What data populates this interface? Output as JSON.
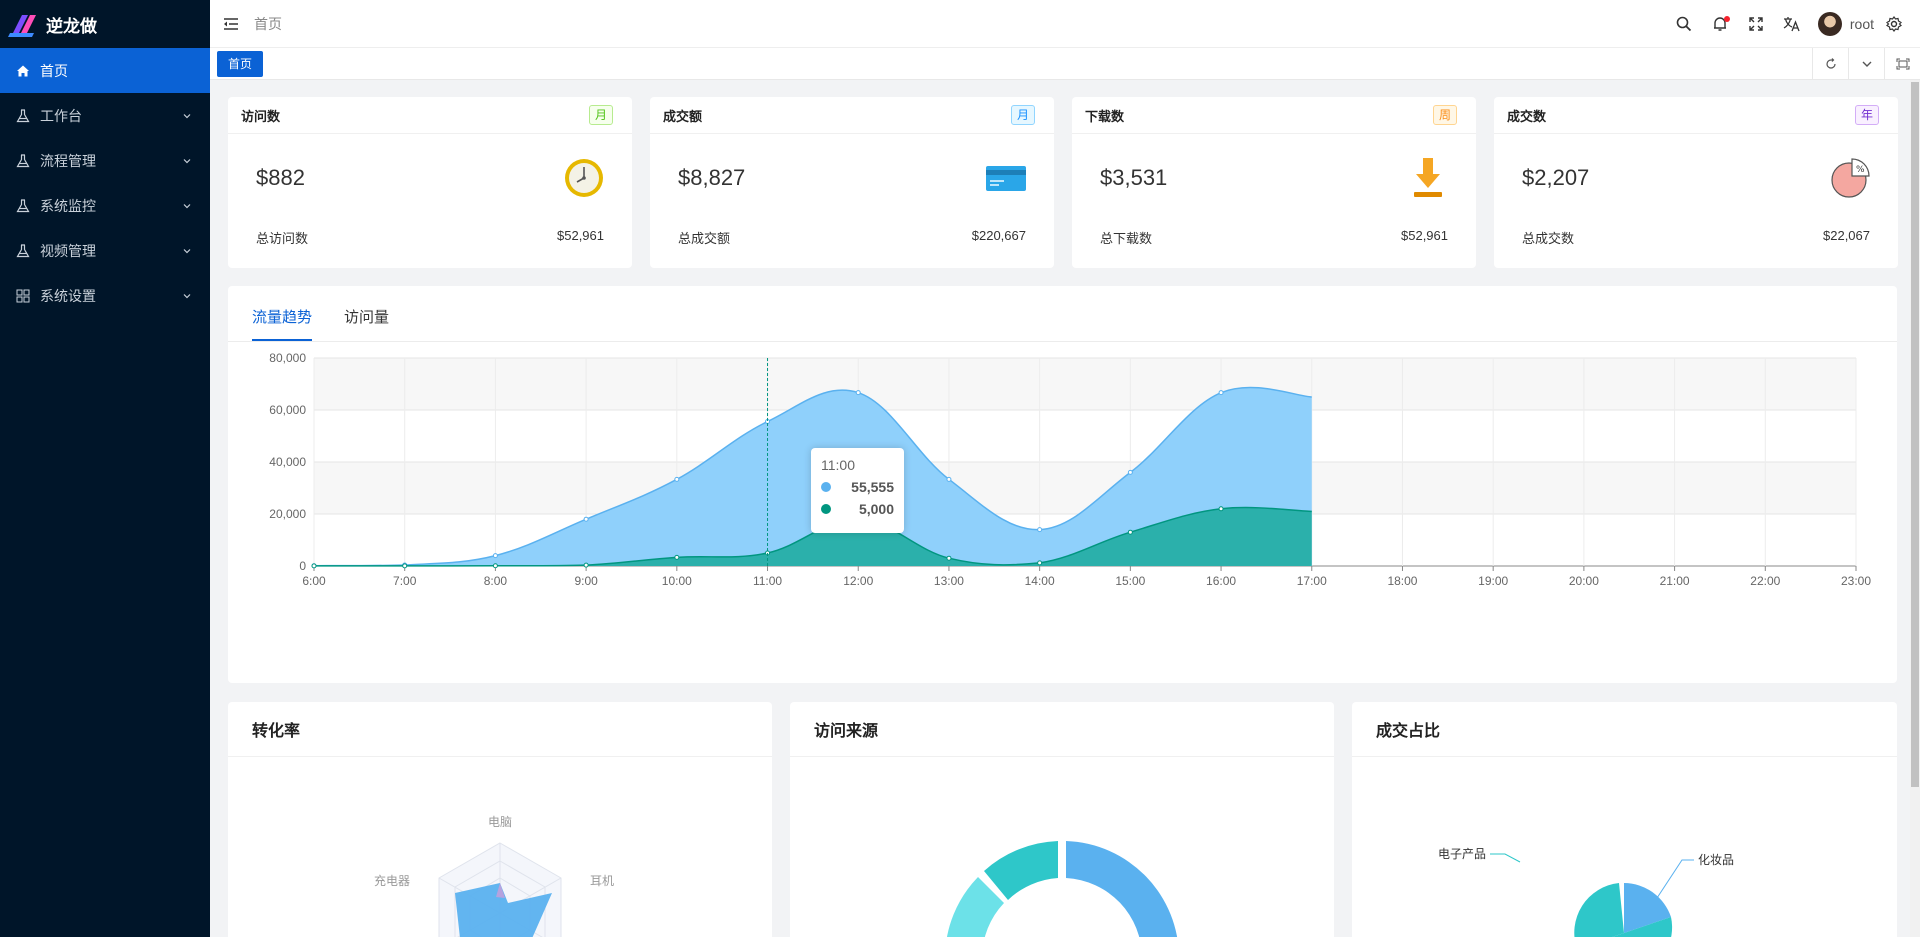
{
  "app": {
    "title": "逆龙做"
  },
  "sidebar": {
    "items": [
      {
        "label": "首页",
        "icon": "home-icon",
        "active": true
      },
      {
        "label": "工作台",
        "icon": "flask-icon"
      },
      {
        "label": "流程管理",
        "icon": "flask-icon"
      },
      {
        "label": "系统监控",
        "icon": "flask-icon"
      },
      {
        "label": "视频管理",
        "icon": "flask-icon"
      },
      {
        "label": "系统设置",
        "icon": "grid-icon"
      }
    ]
  },
  "header": {
    "breadcrumb": "首页",
    "username": "root",
    "has_notification": true
  },
  "tabs": {
    "active": "首页"
  },
  "stats": [
    {
      "title": "访问数",
      "tag": "月",
      "tag_color": "#52c41a",
      "value": "$882",
      "icon": "clock-icon",
      "foot_label": "总访问数",
      "foot_value": "$52,961"
    },
    {
      "title": "成交额",
      "tag": "月",
      "tag_color": "#1890ff",
      "value": "$8,827",
      "icon": "credit-card-icon",
      "foot_label": "总成交额",
      "foot_value": "$220,667"
    },
    {
      "title": "下载数",
      "tag": "周",
      "tag_color": "#fa8c16",
      "value": "$3,531",
      "icon": "download-icon",
      "foot_label": "总下载数",
      "foot_value": "$52,961"
    },
    {
      "title": "成交数",
      "tag": "年",
      "tag_color": "#722ed1",
      "value": "$2,207",
      "icon": "pie-percent-icon",
      "foot_label": "总成交数",
      "foot_value": "$22,067"
    }
  ],
  "trend": {
    "tabs": [
      "流量趋势",
      "访问量"
    ],
    "active_tab": "流量趋势",
    "tooltip": {
      "title": "11:00",
      "rows": [
        {
          "value": "55,555",
          "color": "#5ab1ef"
        },
        {
          "value": "5,000",
          "color": "#019680"
        }
      ]
    }
  },
  "chart_data": {
    "type": "area",
    "x": [
      "6:00",
      "7:00",
      "8:00",
      "9:00",
      "10:00",
      "11:00",
      "12:00",
      "13:00",
      "14:00",
      "15:00",
      "16:00",
      "17:00",
      "18:00",
      "19:00",
      "20:00",
      "21:00",
      "22:00",
      "23:00"
    ],
    "ylim": [
      0,
      80000
    ],
    "yticks": [
      "0",
      "20,000",
      "40,000",
      "60,000",
      "80,000"
    ],
    "series": [
      {
        "values": [
          111,
          400,
          4000,
          18000,
          33333,
          55555,
          66666,
          33333,
          14000,
          36000,
          66666,
          65000
        ],
        "color": "#5ab1ef"
      },
      {
        "values": [
          33,
          66,
          88,
          333,
          3333,
          5000,
          18000,
          3000,
          1200,
          13000,
          22000,
          21000
        ],
        "color": "#019680"
      }
    ],
    "grid": true,
    "crosshair_x": "11:00"
  },
  "bottom": {
    "conversion": {
      "title": "转化率",
      "labels": [
        "电脑",
        "耳机",
        "充电器"
      ]
    },
    "source": {
      "title": "访问来源"
    },
    "share": {
      "title": "成交占比",
      "labels": [
        "化妆品",
        "电子产品"
      ]
    }
  },
  "colors": {
    "sidebar_bg": "#001529",
    "accent": "#0b62d5"
  }
}
